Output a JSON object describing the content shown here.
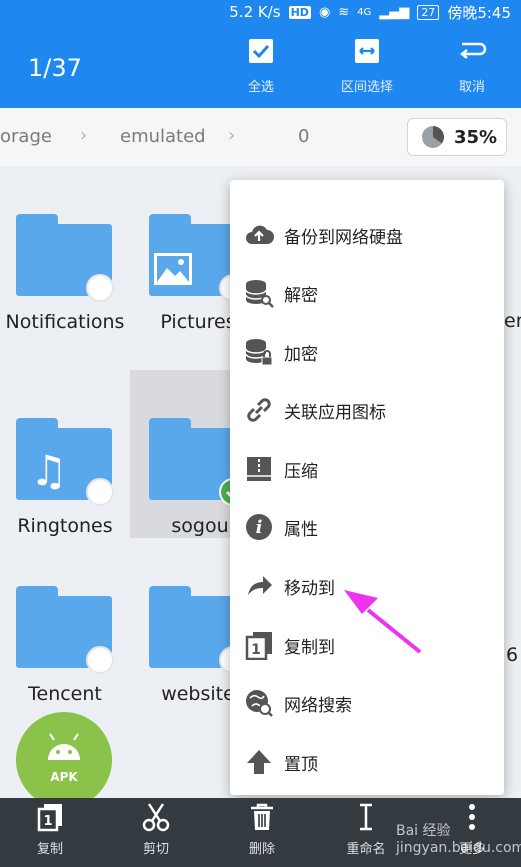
{
  "status": {
    "net": "5.2 K/s",
    "hd": "HD",
    "net_type": "4G",
    "battery": "27",
    "time": "傍晚5:45"
  },
  "header": {
    "count": "1/37",
    "actions": [
      {
        "label": "全选"
      },
      {
        "label": "区间选择"
      },
      {
        "label": "取消"
      }
    ]
  },
  "breadcrumb": {
    "items": [
      "orage",
      "emulated",
      "0"
    ],
    "storage": "35%",
    "storage_used_fraction": 0.35
  },
  "files": [
    {
      "name": "Notifications",
      "checked": false
    },
    {
      "name": "Pictures",
      "checked": false
    },
    {
      "name": "Ringtones",
      "checked": false
    },
    {
      "name": "sogou",
      "checked": true
    },
    {
      "name": "Tencent",
      "checked": false
    },
    {
      "name": "website",
      "checked": false
    }
  ],
  "apk": {
    "label": "APK"
  },
  "edge_text": {
    "row1": "er",
    "row3": "6"
  },
  "menu": {
    "items": [
      {
        "label": "备份到网络硬盘",
        "icon": "cloud-upload-icon"
      },
      {
        "label": "解密",
        "icon": "database-key-icon"
      },
      {
        "label": "加密",
        "icon": "database-lock-icon"
      },
      {
        "label": "关联应用图标",
        "icon": "link-icon"
      },
      {
        "label": "压缩",
        "icon": "archive-icon"
      },
      {
        "label": "属性",
        "icon": "info-icon"
      },
      {
        "label": "移动到",
        "icon": "share-arrow-icon"
      },
      {
        "label": "复制到",
        "icon": "copy-to-icon"
      },
      {
        "label": "网络搜索",
        "icon": "globe-search-icon"
      },
      {
        "label": "置顶",
        "icon": "pin-top-icon"
      }
    ]
  },
  "bottom": {
    "actions": [
      {
        "label": "复制"
      },
      {
        "label": "剪切"
      },
      {
        "label": "删除"
      },
      {
        "label": "重命名"
      },
      {
        "label": "更多"
      }
    ]
  },
  "watermark": "Bai 经验 jingyan.baidu.com",
  "colors": {
    "primary": "#1e87f0",
    "folder": "#5aa8ec",
    "check": "#4cb050",
    "arrow": "#ee33ee"
  }
}
